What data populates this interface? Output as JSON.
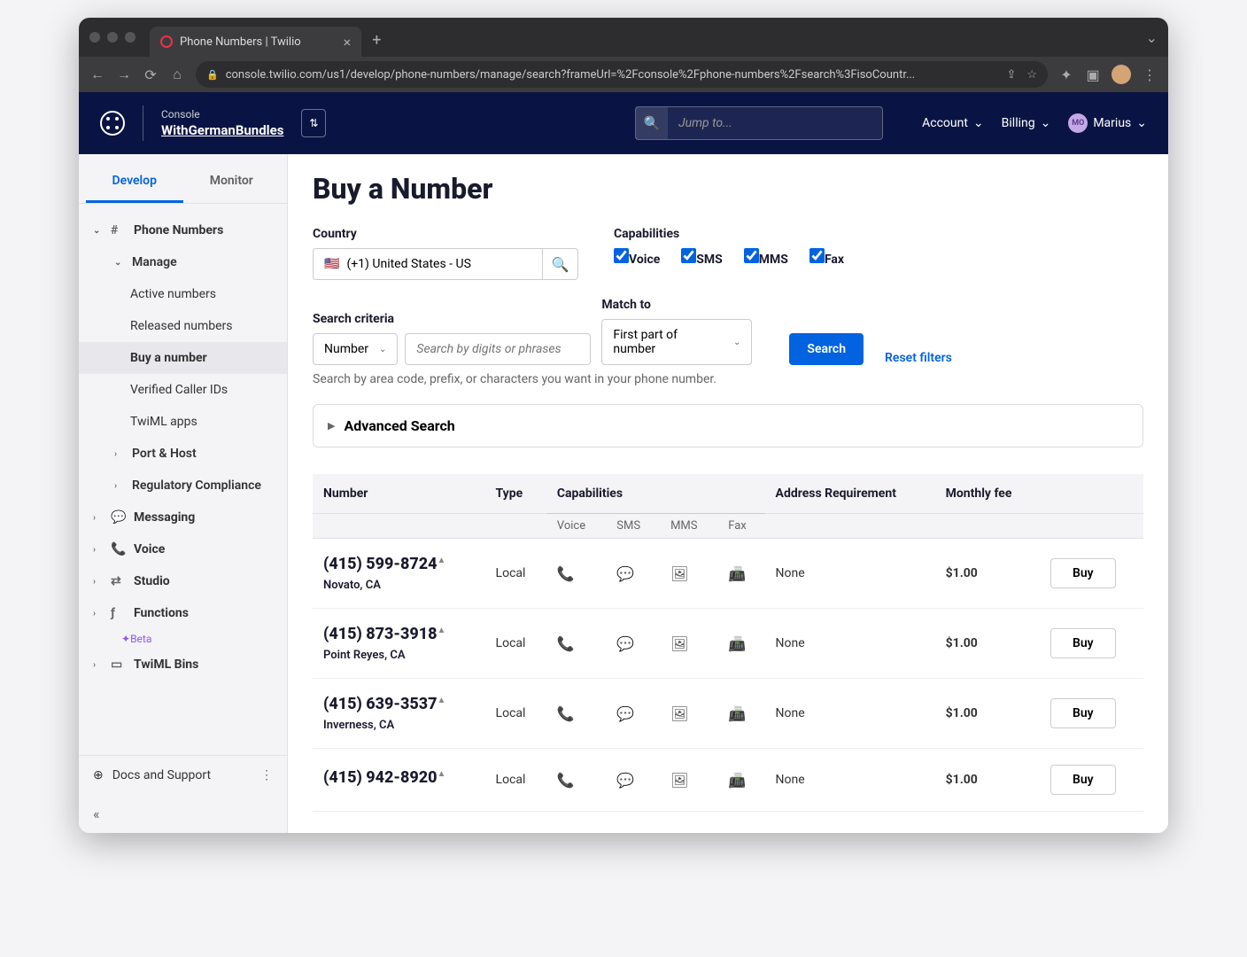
{
  "browser": {
    "tab_title": "Phone Numbers | Twilio",
    "url": "console.twilio.com/us1/develop/phone-numbers/manage/search?frameUrl=%2Fconsole%2Fphone-numbers%2Fsearch%3FisoCountr..."
  },
  "header": {
    "console_label": "Console",
    "console_name": "WithGermanBundles",
    "jump_placeholder": "Jump to...",
    "account": "Account",
    "billing": "Billing",
    "user_initials": "MO",
    "user_name": "Marius"
  },
  "sidebar": {
    "tabs": [
      "Develop",
      "Monitor"
    ],
    "phone_numbers": "Phone Numbers",
    "manage": "Manage",
    "manage_items": [
      "Active numbers",
      "Released numbers",
      "Buy a number",
      "Verified Caller IDs",
      "TwiML apps"
    ],
    "port_host": "Port & Host",
    "reg_compliance": "Regulatory Compliance",
    "messaging": "Messaging",
    "voice": "Voice",
    "studio": "Studio",
    "functions": "Functions",
    "beta": "Beta",
    "twiml_bins": "TwiML Bins",
    "docs": "Docs and Support"
  },
  "main": {
    "title": "Buy a Number",
    "country_label": "Country",
    "country_value": "(+1) United States - US",
    "caps_label": "Capabilities",
    "caps": [
      "Voice",
      "SMS",
      "MMS",
      "Fax"
    ],
    "criteria_label": "Search criteria",
    "criteria_value": "Number",
    "digits_placeholder": "Search by digits or phrases",
    "match_label": "Match to",
    "match_value": "First part of number",
    "search_btn": "Search",
    "reset_btn": "Reset filters",
    "hint": "Search by area code, prefix, or characters you want in your phone number.",
    "advanced": "Advanced Search"
  },
  "table": {
    "headers": [
      "Number",
      "Type",
      "Capabilities",
      "Address Requirement",
      "Monthly fee"
    ],
    "subheaders": [
      "Voice",
      "SMS",
      "MMS",
      "Fax"
    ],
    "buy": "Buy",
    "rows": [
      {
        "number": "(415) 599-8724",
        "location": "Novato, CA",
        "type": "Local",
        "addr": "None",
        "fee": "$1.00"
      },
      {
        "number": "(415) 873-3918",
        "location": "Point Reyes, CA",
        "type": "Local",
        "addr": "None",
        "fee": "$1.00"
      },
      {
        "number": "(415) 639-3537",
        "location": "Inverness, CA",
        "type": "Local",
        "addr": "None",
        "fee": "$1.00"
      },
      {
        "number": "(415) 942-8920",
        "location": "",
        "type": "Local",
        "addr": "None",
        "fee": "$1.00"
      }
    ]
  }
}
